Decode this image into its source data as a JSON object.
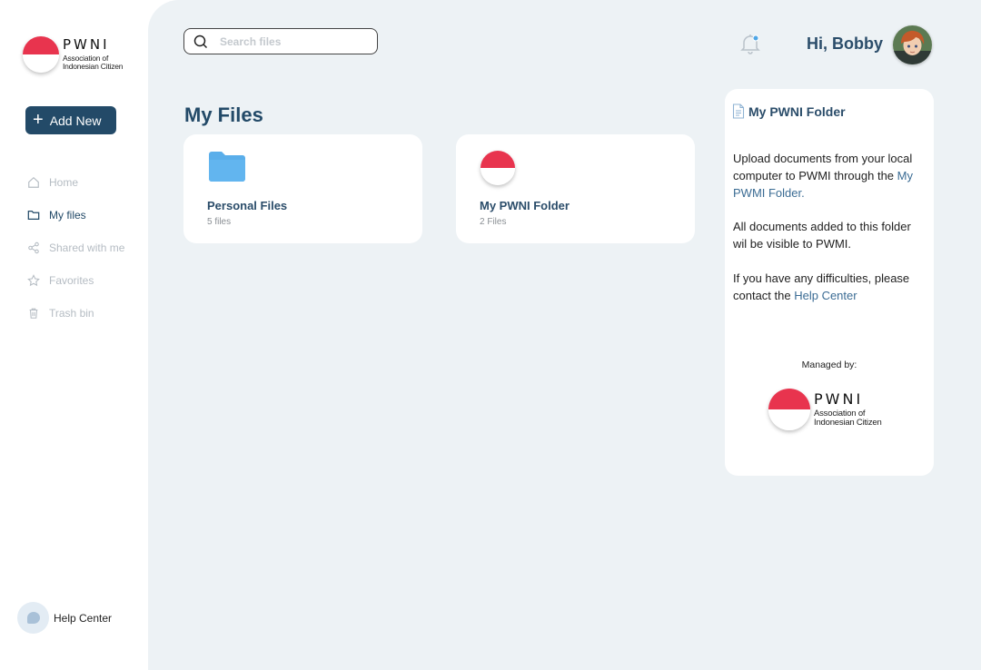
{
  "brand": {
    "name": "PWNI",
    "subtitle_line1": "Association of",
    "subtitle_line2": "Indonesian Citizen",
    "flag_colors": {
      "top": "#e8344e",
      "bottom": "#ffffff"
    }
  },
  "sidebar": {
    "add_new_label": "Add New",
    "items": [
      {
        "label": "Home",
        "icon": "home-icon",
        "active": false
      },
      {
        "label": "My files",
        "icon": "folder-icon",
        "active": true
      },
      {
        "label": "Shared with me",
        "icon": "share-icon",
        "active": false
      },
      {
        "label": "Favorites",
        "icon": "star-icon",
        "active": false
      },
      {
        "label": "Trash bin",
        "icon": "trash-icon",
        "active": false
      }
    ],
    "help_label": "Help Center"
  },
  "header": {
    "search_placeholder": "Search files",
    "greeting": "Hi, Bobby"
  },
  "main": {
    "title": "My Files",
    "folders": [
      {
        "name": "Personal Files",
        "count": "5 files",
        "icon": "folder-icon"
      },
      {
        "name": "My PWNI Folder",
        "count": "2 Files",
        "icon": "flag-icon"
      }
    ]
  },
  "panel": {
    "title": "My PWNI Folder",
    "p1_text": "Upload documents from your local computer to PWMI through the ",
    "p1_link": "My PWMI Folder.",
    "p2_text": "All documents added to this folder wil be visible to PWMI.",
    "p3_text": "If you have any difficulties, please contact the ",
    "p3_link": "Help Center",
    "managed_by": "Managed by:"
  },
  "colors": {
    "accent": "#234a68",
    "background": "#edf2f5",
    "folder": "#5aaeea",
    "notification_dot": "#4ea6e6"
  }
}
